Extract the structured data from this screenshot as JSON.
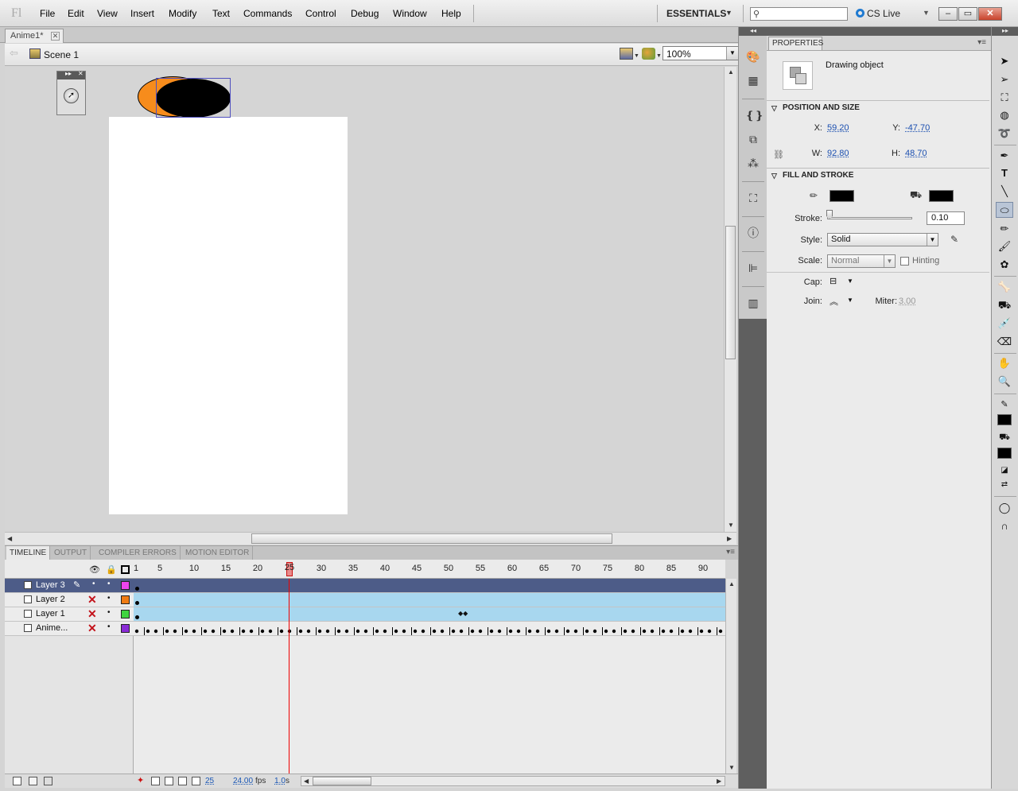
{
  "app": {
    "logo": "Fl",
    "menus": [
      "File",
      "Edit",
      "View",
      "Insert",
      "Modify",
      "Text",
      "Commands",
      "Control",
      "Debug",
      "Window",
      "Help"
    ],
    "workspace": "ESSENTIALS",
    "search": {
      "placeholder": "",
      "value": ""
    },
    "cs_live": "CS Live",
    "window_controls": {
      "minimize": "–",
      "restore": "▭",
      "close": "✕"
    }
  },
  "document": {
    "tab_label": "Anime1*",
    "scene_label": "Scene 1",
    "zoom": "100%"
  },
  "stage": {
    "background_color": "#ffffff",
    "shapes": [
      {
        "name": "orange-ellipse",
        "fill": "#f78c1c"
      },
      {
        "name": "black-ellipse",
        "fill": "#000000"
      }
    ]
  },
  "timeline": {
    "tabs": [
      "TIMELINE",
      "OUTPUT",
      "COMPILER ERRORS",
      "MOTION EDITOR"
    ],
    "ruler_labels": [
      "1",
      "5",
      "10",
      "15",
      "20",
      "25",
      "30",
      "35",
      "40",
      "45",
      "50",
      "55",
      "60",
      "65",
      "70",
      "75",
      "80",
      "85",
      "90"
    ],
    "current_frame": "25",
    "layers": [
      {
        "name": "Layer 3",
        "color": "#ee44ee",
        "selected": true
      },
      {
        "name": "Layer 2",
        "color": "#f07b13",
        "selected": false
      },
      {
        "name": "Layer 1",
        "color": "#3fd43f",
        "selected": false
      },
      {
        "name": "Anime...",
        "color": "#8a2bd6",
        "selected": false
      }
    ],
    "footer": {
      "frame": "25",
      "fps": "24.00",
      "fps_unit": "fps",
      "time": "1.0",
      "time_unit": "s"
    }
  },
  "properties": {
    "tab": "PROPERTIES",
    "object_type": "Drawing object",
    "position_size": {
      "header": "POSITION AND SIZE",
      "x_label": "X:",
      "x": "59.20",
      "y_label": "Y:",
      "y": "-47.70",
      "w_label": "W:",
      "w": "92.80",
      "h_label": "H:",
      "h": "48.70"
    },
    "fill_stroke": {
      "header": "FILL AND STROKE",
      "stroke_color": "#000000",
      "fill_color": "#000000",
      "stroke_label": "Stroke:",
      "stroke_value": "0.10",
      "style_label": "Style:",
      "style": "Solid",
      "scale_label": "Scale:",
      "scale": "Normal",
      "hinting_label": "Hinting",
      "cap_label": "Cap:",
      "join_label": "Join:",
      "miter_label": "Miter:",
      "miter": "3.00"
    }
  },
  "tools": [
    "selection-tool",
    "subselection-tool",
    "free-transform-tool",
    "3d-rotation-tool",
    "lasso-tool",
    "pen-tool",
    "text-tool",
    "line-tool",
    "oval-tool",
    "pencil-tool",
    "brush-tool",
    "deco-tool",
    "bone-tool",
    "paint-bucket-tool",
    "eyedropper-tool",
    "eraser-tool",
    "hand-tool",
    "zoom-tool"
  ]
}
